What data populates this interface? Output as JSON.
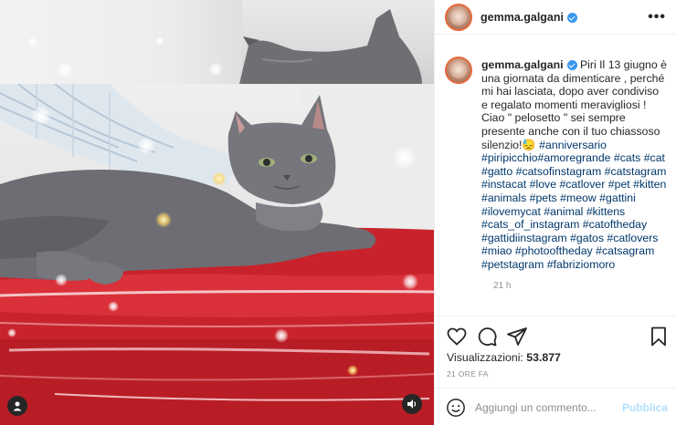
{
  "post": {
    "username": "gemma.galgani",
    "verified": true,
    "more_icon": "more-options-icon"
  },
  "caption": {
    "username": "gemma.galgani",
    "text": "Piri Il 13 giugno è una giornata da dimenticare , perché mi hai lasciata, dopo aver condiviso e regalato momenti meravigliosi ! Ciao \" pelosetto \" sei sempre presente anche con il tuo chiassoso silenzio!😓",
    "hashtags": "#anniversario #piripicchio#amoregrande #cats #cat #gatto #catsofinstagram #catstagram #instacat #love #catlover #pet #kitten #animals #pets #meow #gattini #ilovemycat #animal #kittens #cats_of_instagram #catoftheday #gattidiinstagram #gatos #catlovers #miao #photooftheday #catsagram #petstagram #fabriziomoro",
    "time_ago": "21 h"
  },
  "actions": {
    "icons": [
      "heart-icon",
      "comment-icon",
      "share-icon",
      "bookmark-icon"
    ],
    "views_label": "Visualizzazioni:",
    "views_count": "53.877",
    "date": "21 ORE FA"
  },
  "comment": {
    "placeholder": "Aggiungi un commento...",
    "publish_label": "Pubblica",
    "emoji_icon": "emoji-icon"
  },
  "media": {
    "type": "video",
    "user_tag_icon": "user-tag-icon",
    "sound_icon": "speaker-icon"
  },
  "colors": {
    "link": "#00376b",
    "verified": "#3897f0",
    "publish_disabled": "#b2dffc",
    "muted": "#8e8e8e"
  }
}
